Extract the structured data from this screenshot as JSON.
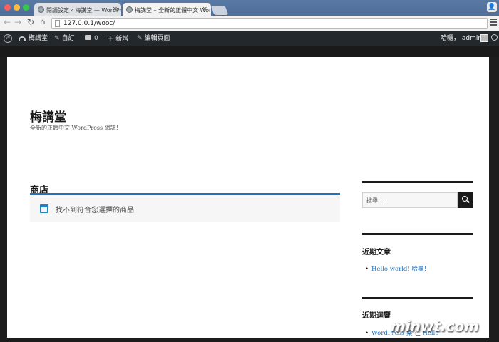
{
  "browser": {
    "tabs": [
      {
        "label": "閱讀設定 ‹ 梅講堂 — WordPress"
      },
      {
        "label": "梅講堂 – 全新的正體中文 WordPress"
      }
    ],
    "url": "127.0.0.1/wooc/"
  },
  "admin_bar": {
    "site_name": "梅講堂",
    "customize": "自訂",
    "comments_count": "0",
    "new": "新增",
    "edit_page": "編輯頁面",
    "greeting": "哈囉，",
    "username": "admin"
  },
  "site": {
    "title": "梅講堂",
    "description": "全新的正體中文 WordPress 網誌！"
  },
  "main": {
    "heading": "商店",
    "notice": "找不到符合您選擇的商品"
  },
  "sidebar": {
    "search_placeholder": "搜尋 …",
    "recent_posts_heading": "近期文章",
    "recent_posts": [
      "Hello world! 哈囉！"
    ],
    "recent_comments_heading": "近期迴響",
    "recent_comments": [
      {
        "author": "WordPress 桑",
        "joiner": "在",
        "post": "Hello"
      }
    ]
  },
  "watermark": "minwt.com",
  "colors": {
    "admin_bar": "#23282d",
    "link": "#1e73be",
    "accent_rule": "#1e73be"
  }
}
